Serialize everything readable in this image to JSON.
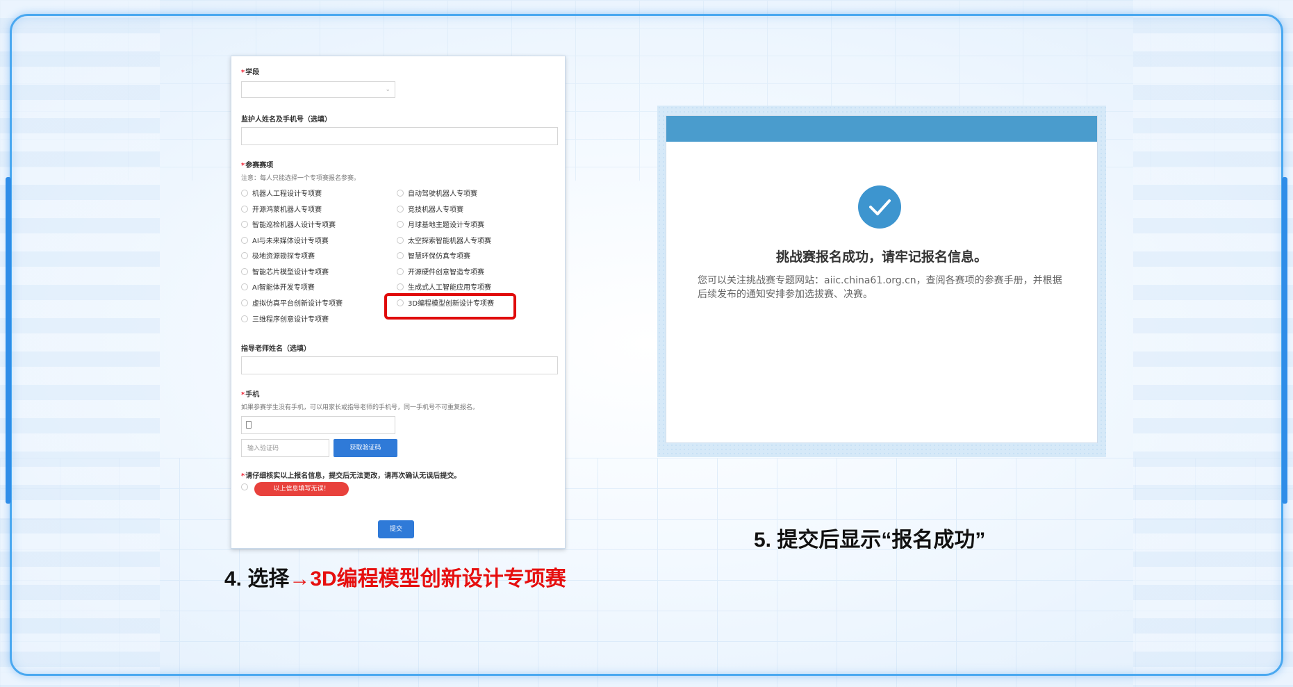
{
  "form": {
    "grade_label": "学段",
    "grade_required": "*",
    "guardian_label": "监护人姓名及手机号（选填）",
    "event_label": "参赛赛项",
    "event_required": "*",
    "event_note": "注意：每人只能选择一个专项赛报名参赛。",
    "events_left": [
      "机器人工程设计专项赛",
      "开源鸿蒙机器人专项赛",
      "智能巡检机器人设计专项赛",
      "AI与未来媒体设计专项赛",
      "极地资源勘探专项赛",
      "智能芯片模型设计专项赛",
      "AI智能体开发专项赛",
      "虚拟仿真平台创新设计专项赛",
      "三维程序创意设计专项赛"
    ],
    "events_right": [
      "自动驾驶机器人专项赛",
      "竞技机器人专项赛",
      "月球基地主题设计专项赛",
      "太空探索智能机器人专项赛",
      "智慧环保仿真专项赛",
      "开源硬件创意智造专项赛",
      "生成式人工智能应用专项赛",
      "3D编程模型创新设计专项赛"
    ],
    "teacher_label": "指导老师姓名（选填）",
    "phone_label": "手机",
    "phone_required": "*",
    "phone_note": "如果参赛学生没有手机，可以用家长或指导老师的手机号，同一手机号不可重复报名。",
    "code_placeholder": "输入验证码",
    "get_code_button": "获取验证码",
    "confirm_note": "请仔细核实以上报名信息，提交后无法更改，请再次确认无误后提交。",
    "confirm_required": "*",
    "confirm_option": "以上信息填写无误！",
    "submit_button": "提交"
  },
  "success": {
    "title": "挑战赛报名成功，请牢记报名信息。",
    "description": "您可以关注挑战赛专题网站：aiic.china61.org.cn，查阅各赛项的参赛手册，并根据后续发布的通知安排参加选拔赛、决赛。"
  },
  "captions": {
    "step4_prefix": "4. 选择",
    "step4_highlight": "→3D编程模型创新设计专项赛",
    "step5": "5. 提交后显示“报名成功”"
  },
  "colors": {
    "frame_blue": "#4aa8f0",
    "header_blue": "#4a9ccd",
    "highlight_red": "#e00a0a",
    "button_blue": "#2f7ad8"
  }
}
